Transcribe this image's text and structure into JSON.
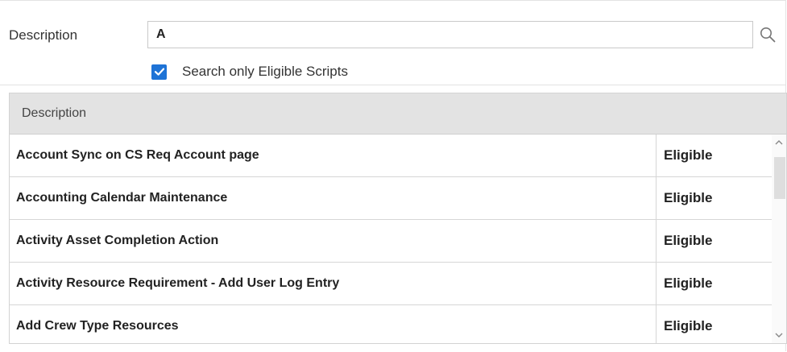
{
  "filter": {
    "description_label": "Description",
    "search_value": "A",
    "eligible_only": {
      "checked": true,
      "label": "Search only Eligible Scripts"
    }
  },
  "grid": {
    "header": "Description",
    "rows": [
      {
        "description": "Account Sync on CS Req Account page",
        "status": "Eligible"
      },
      {
        "description": "Accounting Calendar Maintenance",
        "status": "Eligible"
      },
      {
        "description": "Activity Asset Completion Action",
        "status": "Eligible"
      },
      {
        "description": "Activity Resource Requirement - Add User Log Entry",
        "status": "Eligible"
      },
      {
        "description": "Add Crew Type Resources",
        "status": "Eligible"
      }
    ]
  },
  "icons": {
    "search": "search-icon",
    "checkbox": "checkmark-icon",
    "scroll_up": "chevron-up-icon",
    "scroll_down": "chevron-down-icon"
  },
  "colors": {
    "checkbox": "#1e73d6",
    "header_bg": "#e3e3e3"
  }
}
